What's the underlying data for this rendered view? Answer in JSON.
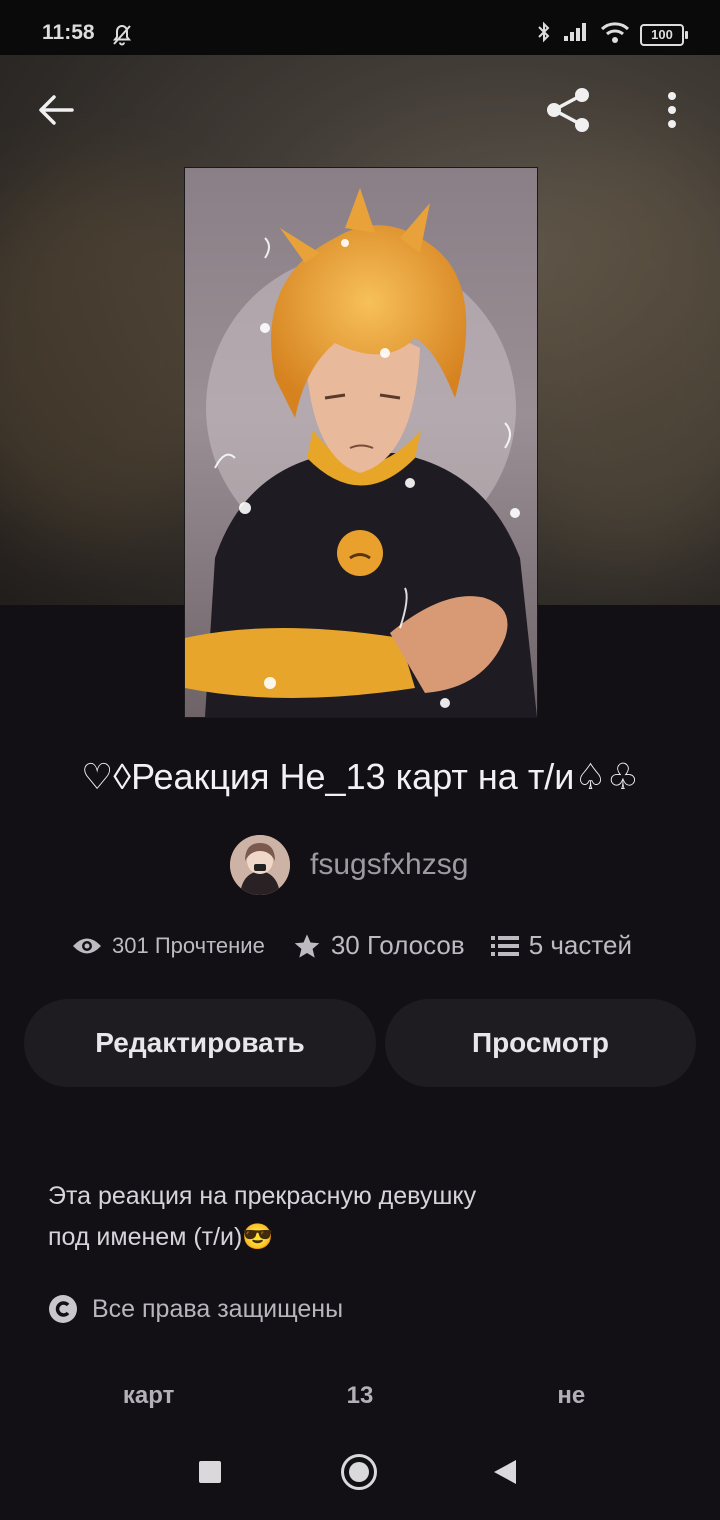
{
  "status": {
    "time": "11:58",
    "battery": "100"
  },
  "story": {
    "title": "♡◊Реакция Не_13 карт на т/и♤♧",
    "author": "fsugsfxhzsg",
    "reads": "301 Прочтение",
    "votes": "30 Голосов",
    "parts": "5 частей",
    "description_line1": "Эта реакция на прекрасную девушку",
    "description_line2": "под именем (т/и)😎",
    "rights": "Все права защищены",
    "tags": [
      "карт",
      "13",
      "не"
    ]
  },
  "buttons": {
    "edit": "Редактировать",
    "view": "Просмотр"
  },
  "icons": [
    "back-arrow-icon",
    "share-icon",
    "more-vert-icon",
    "eye-icon",
    "star-icon",
    "list-icon",
    "copyright-icon",
    "dnd-bell-icon",
    "bluetooth-icon",
    "signal-icon",
    "wifi-icon"
  ]
}
